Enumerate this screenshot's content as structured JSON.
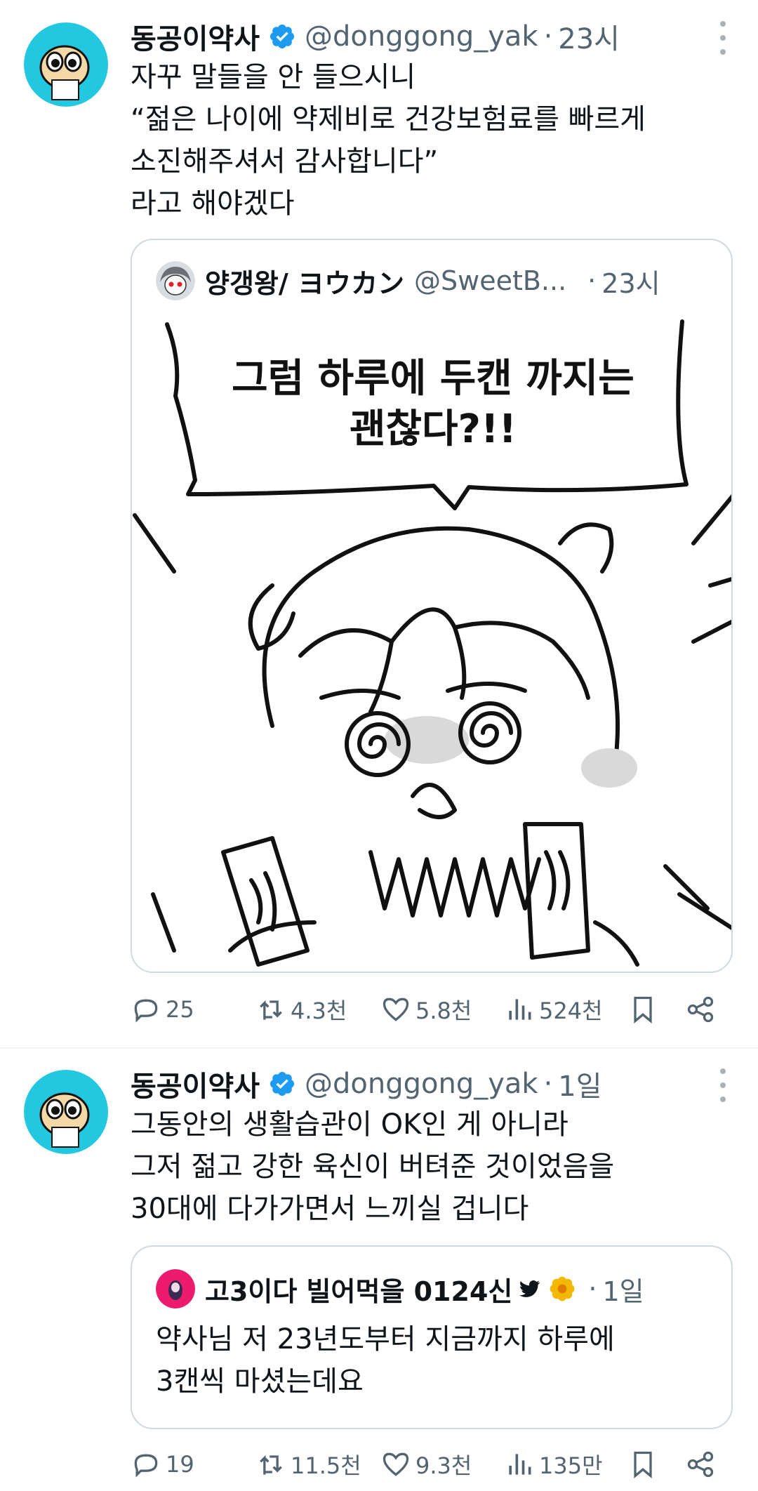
{
  "tweets": [
    {
      "name": "동공이약사",
      "handle": "@donggong_yak",
      "dot": "·",
      "time": "23시",
      "text_lines": [
        "자꾸 말들을 안 들으시니",
        "“젊은 나이에 약제비로 건강보험료를 빠르게",
        "소진해주셔서 감사합니다”",
        "라고 해야겠다"
      ],
      "quote": {
        "name": "양갱왕/ ヨウカン",
        "handle": "@SweetB...",
        "dot": "·",
        "time": "23시",
        "comic_text_lines": [
          "그럼 하루에 두캔 까지는",
          "괜찮다?!!"
        ]
      },
      "actions": {
        "replies": "25",
        "reposts": "4.3천",
        "likes": "5.8천",
        "views": "524천"
      }
    },
    {
      "name": "동공이약사",
      "handle": "@donggong_yak",
      "dot": "·",
      "time": "1일",
      "text_lines": [
        "그동안의 생활습관이 OK인 게 아니라",
        "그저 젊고 강한 육신이 버텨준 것이었음을",
        "30대에 다가가면서 느끼실 겁니다"
      ],
      "quote": {
        "name": "고3이다 빌어먹을 0124신",
        "dot": "·",
        "time": "1일",
        "text_lines": [
          "약사님 저 23년도부터 지금까지 하루에",
          "3캔씩 마셨는데요"
        ]
      },
      "actions": {
        "replies": "19",
        "reposts": "11.5천",
        "likes": "9.3천",
        "views": "135만"
      }
    }
  ],
  "icons": {
    "verified": "verified-badge-icon",
    "more": "more-icon",
    "reply": "reply-icon",
    "repost": "repost-icon",
    "like": "like-icon",
    "views": "views-icon",
    "bookmark": "bookmark-icon",
    "share": "share-icon",
    "bird": "bird-icon",
    "flower": "flower-icon"
  },
  "colors": {
    "verified": "#1d9bf0",
    "avatar_bg": "#22c7e0",
    "secondary_text": "#536471",
    "border": "#cfd9de",
    "quote_avatar": "#ec1b6d"
  }
}
